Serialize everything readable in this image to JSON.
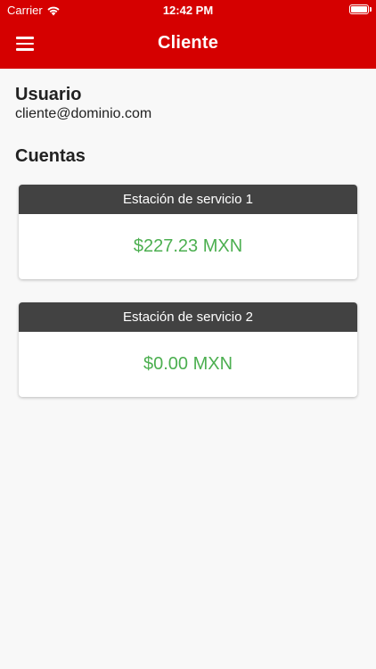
{
  "status_bar": {
    "carrier": "Carrier",
    "time": "12:42 PM"
  },
  "header": {
    "title": "Cliente",
    "menu_icon": "hamburger-menu-icon",
    "background": "#d50000"
  },
  "user": {
    "label": "Usuario",
    "email": "cliente@dominio.com"
  },
  "accounts": {
    "title": "Cuentas",
    "items": [
      {
        "name": "Estación de servicio 1",
        "balance": "$227.23 MXN"
      },
      {
        "name": "Estación de servicio 2",
        "balance": "$0.00 MXN"
      }
    ],
    "balance_color": "#4caf50",
    "card_header_color": "#424242"
  }
}
